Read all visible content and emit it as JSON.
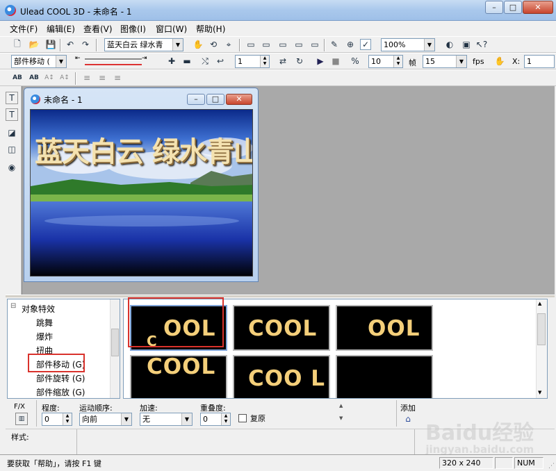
{
  "window": {
    "title": "Ulead COOL 3D - 未命名 - 1",
    "min": "–",
    "max": "□",
    "close": "✕"
  },
  "menu": [
    "文件(F)",
    "编辑(E)",
    "查看(V)",
    "图像(I)",
    "窗口(W)",
    "帮助(H)"
  ],
  "toolbar1": {
    "text_combo": "蓝天白云  绿水青",
    "zoom_combo": "100%"
  },
  "toolbar2": {
    "object_combo": "部件移动 (",
    "frame_value": "1",
    "speed_value": "10",
    "frame_label": "帧",
    "fps_value": "15",
    "fps_label": "fps",
    "x_label": "X:",
    "x_value": "1"
  },
  "toolbar3": {
    "ab1": "AB",
    "ab2": "AB",
    "ab3": "A↕",
    "ab4": "A↕"
  },
  "document": {
    "title": "未命名 - 1",
    "canvas_text": "蓝天白云 绿水青山"
  },
  "tree": {
    "root": "对象特效",
    "items": [
      "跳舞",
      "爆炸",
      "扭曲",
      "部件移动 (G)",
      "部件旋转 (G)",
      "部件缩放 (G)"
    ]
  },
  "thumbnails": [
    {
      "main": "OOL",
      "extra": "C"
    },
    {
      "main": "COOL",
      "extra": ""
    },
    {
      "main": "OOL",
      "extra": ""
    },
    {
      "main": "COOL",
      "extra": ""
    },
    {
      "main": "COO L",
      "extra": ""
    },
    {
      "main": "",
      "extra": ""
    }
  ],
  "props": {
    "fx_label": "F/X",
    "degree_label": "程度:",
    "degree_value": "0",
    "order_label": "运动顺序:",
    "order_value": "向前",
    "accel_label": "加速:",
    "accel_value": "无",
    "overlap_label": "重叠度:",
    "overlap_value": "0",
    "restore_label": "复原",
    "add_label": "添加"
  },
  "style_label": "样式:",
  "status": {
    "help": "要获取「帮助」，请按 F1 键",
    "size": "320 x 240",
    "num": "NUM"
  },
  "watermark": {
    "text": "Baidu经验",
    "sub": "jingyan.baidu.com"
  },
  "colors": {
    "title_grad": "#a9c8ec",
    "workspace": "#a9a9a9",
    "highlight": "#d9322c",
    "thumb_text": "#f4cf7a"
  }
}
